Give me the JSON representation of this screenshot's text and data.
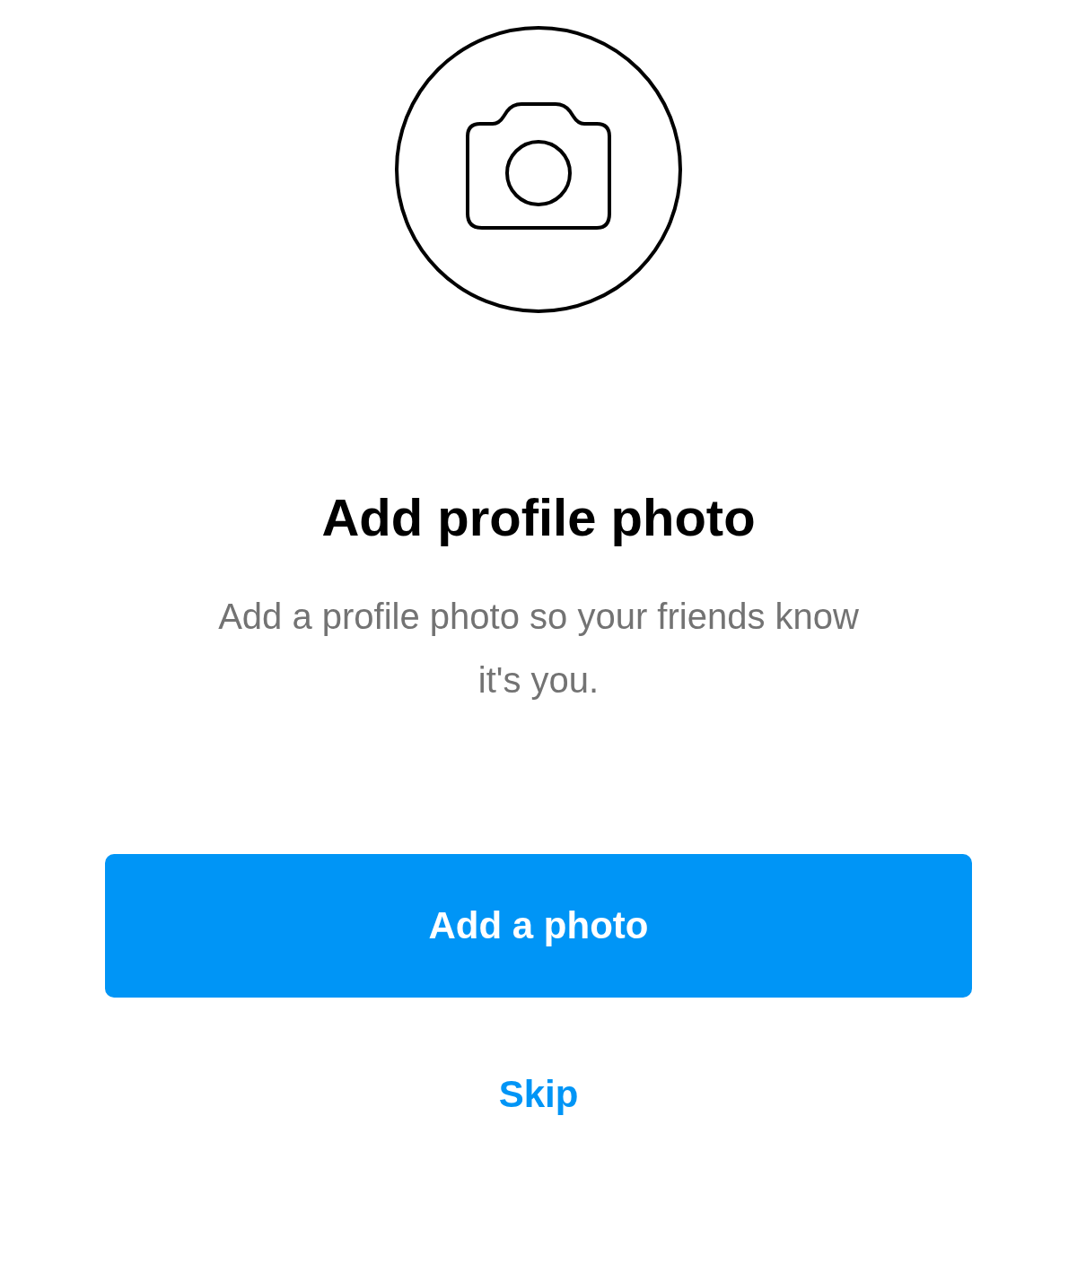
{
  "title": "Add profile photo",
  "description": "Add a profile photo so your friends know it's you.",
  "primary_button": {
    "label": "Add a photo"
  },
  "secondary_link": {
    "label": "Skip"
  }
}
